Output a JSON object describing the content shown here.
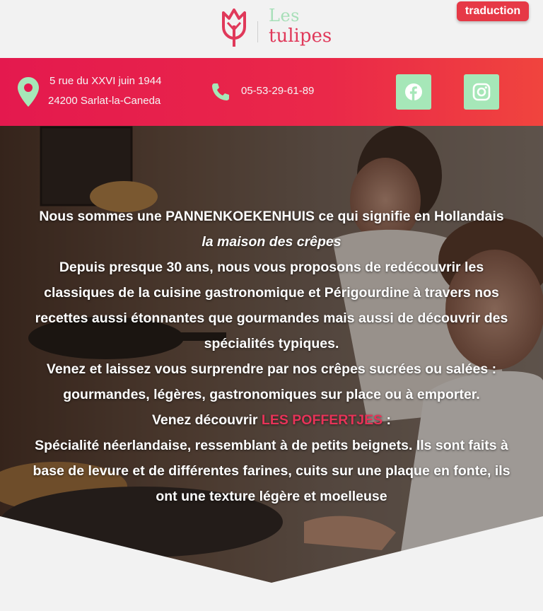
{
  "header": {
    "logo": {
      "line1": "Les",
      "line2": "tulipes",
      "icon": "tulip-icon"
    },
    "translate_label": "traduction"
  },
  "infobar": {
    "address_line1": "5 rue du XXVI juin 1944",
    "address_line2": "24200 Sarlat-la-Caneda",
    "phone": "05-53-29-61-89",
    "icons": [
      "location-pin-icon",
      "phone-icon",
      "facebook-icon",
      "instagram-icon"
    ]
  },
  "hero": {
    "line1": "Nous sommes une PANNENKOEKENHUIS ce qui signifie en Hollandais",
    "line2_italic": "la maison des crêpes",
    "line3": "Depuis presque 30 ans, nous vous proposons de redécouvrir les",
    "line4": "classiques de la cuisine gastronomique et Périgourdine à travers nos",
    "line5": "recettes aussi étonnantes que gourmandes mais aussi de découvrir des",
    "line6": "spécialités typiques.",
    "line7": "Venez et laissez vous surprendre par nos crêpes sucrées ou salées :",
    "line8": "gourmandes, légères, gastronomiques sur place ou à emporter.",
    "line9_prefix": "Venez découvrir ",
    "line9_link": "LES POFFERTJES",
    "line9_suffix": " :",
    "line10": "Spécialité néerlandaise, ressemblant à de petits beignets. Ils sont faits à",
    "line11": "base de levure et de différentes farines, cuits sur une plaque en fonte, ils",
    "line12": "ont une texture légère et moelleuse"
  },
  "colors": {
    "brand_red": "#e4194e",
    "accent_green": "#a6e7b8",
    "button_red": "#e63946",
    "link_pink": "#e63358"
  }
}
